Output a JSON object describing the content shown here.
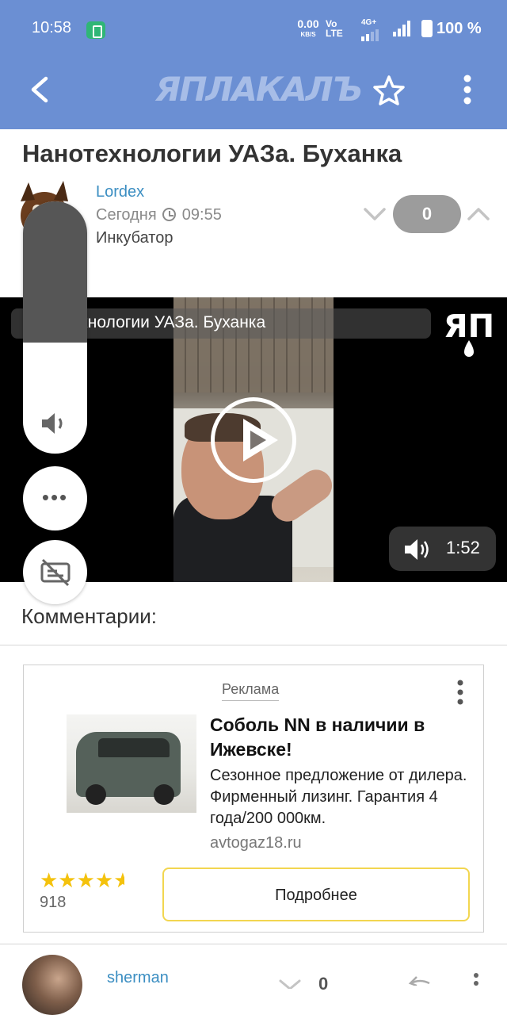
{
  "status_bar": {
    "time": "10:58",
    "net_speed_value": "0.00",
    "net_speed_unit": "KB/S",
    "volte_top": "Vo",
    "volte_bottom": "LTE",
    "network": "4G+",
    "battery": "100 %"
  },
  "header": {
    "logo_text": "ЯПЛАКАЛЪ",
    "back_icon": "back-arrow-icon",
    "star_icon": "star-icon",
    "menu_icon": "kebab-menu-icon",
    "background_color": "#6b8fd3"
  },
  "post": {
    "title": "Нанотехнологии УАЗа. Буханка",
    "author": "Lordex",
    "date_label": "Сегодня",
    "time": "09:55",
    "category": "Инкубатор",
    "votes": "0"
  },
  "video": {
    "title": "Нанотехнологии УАЗа. Буханка",
    "duration": "1:52",
    "watermark": "ЯП",
    "play_icon": "play-icon",
    "volume_icon": "volume-icon"
  },
  "overlay": {
    "volume_level": 0.44,
    "more_label": "•••",
    "speaker_icon": "speaker-icon",
    "caption_icon": "captions-off-icon"
  },
  "comments": {
    "heading": "Комментарии:"
  },
  "ad": {
    "label": "Реклама",
    "headline": "Соболь NN в наличии в Ижевске!",
    "description": "Сезонное предложение от дилера. Фирменный лизинг. Гарантия 4 года/200 000км.",
    "domain": "avtogaz18.ru",
    "stars": "★★★★",
    "rating": 4.5,
    "rating_count": "918",
    "cta": "Подробнее",
    "cta_border_color": "#f2d650"
  },
  "next_comment": {
    "user": "sherman",
    "votes": "0"
  }
}
